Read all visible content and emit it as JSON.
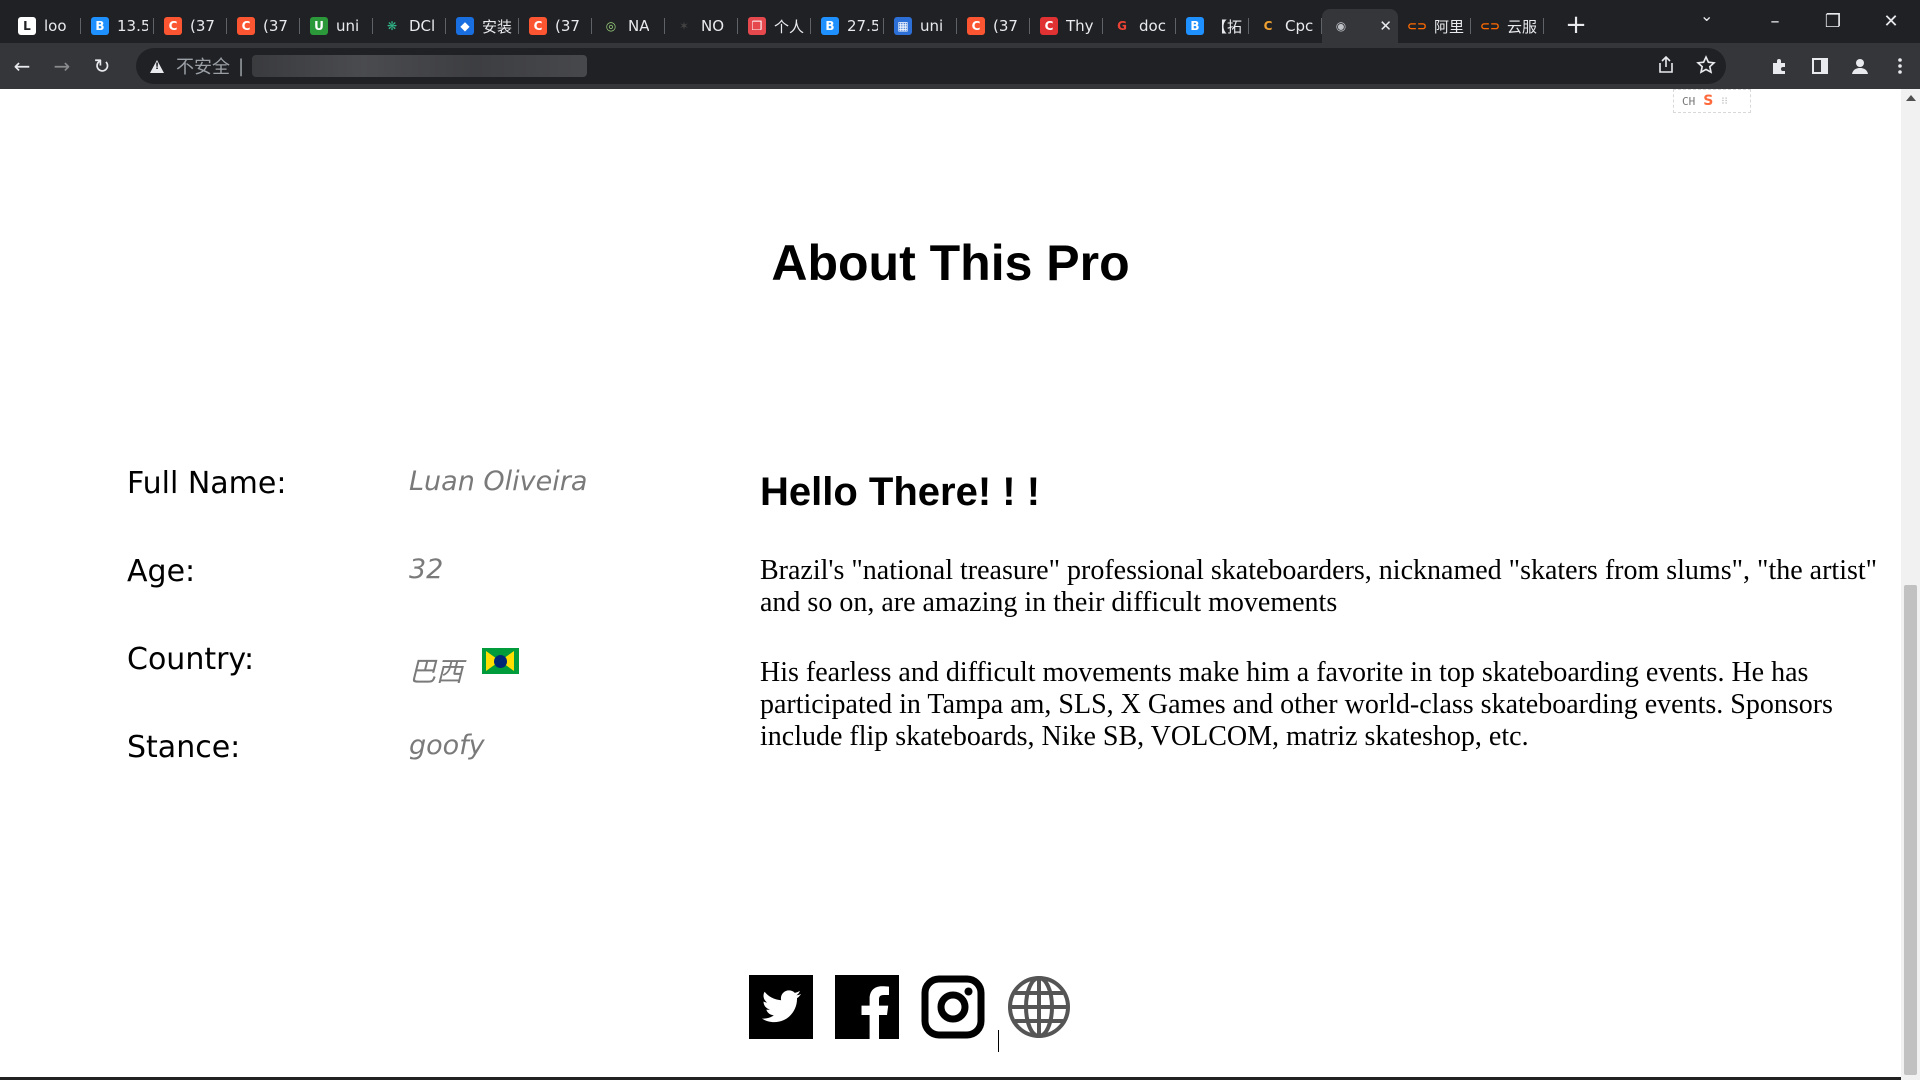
{
  "browser": {
    "tabs": [
      {
        "title": "loo",
        "favicon": "L",
        "color": "#ffffff",
        "fg": "#202124"
      },
      {
        "title": "13.5",
        "favicon": "B",
        "color": "#1e90ff",
        "fg": "#ffffff"
      },
      {
        "title": "(37",
        "favicon": "C",
        "color": "#fc5531",
        "fg": "#ffffff"
      },
      {
        "title": "(37",
        "favicon": "C",
        "color": "#fc5531",
        "fg": "#ffffff"
      },
      {
        "title": "uni",
        "favicon": "U",
        "color": "#2b9939",
        "fg": "#ffffff"
      },
      {
        "title": "DCl",
        "favicon": "❋",
        "color": "#202124",
        "fg": "#2fb88a"
      },
      {
        "title": "安装",
        "favicon": "◆",
        "color": "#1a6fe0",
        "fg": "#ffffff"
      },
      {
        "title": "(37",
        "favicon": "C",
        "color": "#fc5531",
        "fg": "#ffffff"
      },
      {
        "title": "NA",
        "favicon": "◎",
        "color": "#202124",
        "fg": "#9bd17c"
      },
      {
        "title": "NO",
        "favicon": "✶",
        "color": "#202124",
        "fg": "#444444"
      },
      {
        "title": "个人",
        "favicon": "❒",
        "color": "#e5484d",
        "fg": "#ffffff"
      },
      {
        "title": "27.5",
        "favicon": "B",
        "color": "#1e90ff",
        "fg": "#ffffff"
      },
      {
        "title": "uni",
        "favicon": "▦",
        "color": "#2c6fd6",
        "fg": "#ffffff"
      },
      {
        "title": "(37",
        "favicon": "C",
        "color": "#fc5531",
        "fg": "#ffffff"
      },
      {
        "title": "Thy",
        "favicon": "C",
        "color": "#e03232",
        "fg": "#ffffff"
      },
      {
        "title": "doc",
        "favicon": "G",
        "color": "#202124",
        "fg": "#ea4335"
      },
      {
        "title": "【拓",
        "favicon": "B",
        "color": "#1e90ff",
        "fg": "#ffffff"
      },
      {
        "title": "Cpc",
        "favicon": "C",
        "color": "#202124",
        "fg": "#f0a030"
      },
      {
        "title": "",
        "favicon": "◉",
        "color": "#35363a",
        "fg": "#bdc1c6",
        "active": true
      },
      {
        "title": "阿里",
        "favicon": "⊂⊃",
        "color": "#202124",
        "fg": "#ff6a00"
      },
      {
        "title": "云服",
        "favicon": "⊂⊃",
        "color": "#202124",
        "fg": "#ff6a00"
      }
    ],
    "new_tab": "+",
    "tab_search": "⌄",
    "window_controls": [
      "–",
      "❐",
      "✕"
    ],
    "nav": {
      "back": "←",
      "forward": "→",
      "reload": "↻"
    },
    "security_label": "不安全",
    "separator": "|",
    "omnibox_icons": [
      "share-icon",
      "star-icon"
    ],
    "toolbar_icons": [
      "extensions-icon",
      "sidepanel-icon",
      "profile-icon",
      "menu-icon"
    ]
  },
  "ime": {
    "lang": "CH",
    "badge": "S",
    "dots": "⁝⁝"
  },
  "page": {
    "title": "About This Pro",
    "details": [
      {
        "label": "Full Name:",
        "value": "Luan Oliveira"
      },
      {
        "label": "Age:",
        "value": "32"
      },
      {
        "label": "Country:",
        "value": "巴西",
        "flag": "brazil-flag"
      },
      {
        "label": "Stance:",
        "value": "goofy"
      }
    ],
    "heading": "Hello There! ! !",
    "paragraphs": [
      "Brazil's \"national treasure\" professional skateboarders, nicknamed \"skaters from slums\", \"the artist\" and so on, are amazing in their difficult movements",
      "His fearless and difficult movements make him a favorite in top skateboarding events. He has participated in Tampa am, SLS, X Games and other world-class skateboarding events. Sponsors include flip skateboards, Nike SB, VOLCOM, matriz skateshop, etc."
    ],
    "social": [
      "twitter-icon",
      "facebook-icon",
      "instagram-icon",
      "globe-icon"
    ]
  }
}
